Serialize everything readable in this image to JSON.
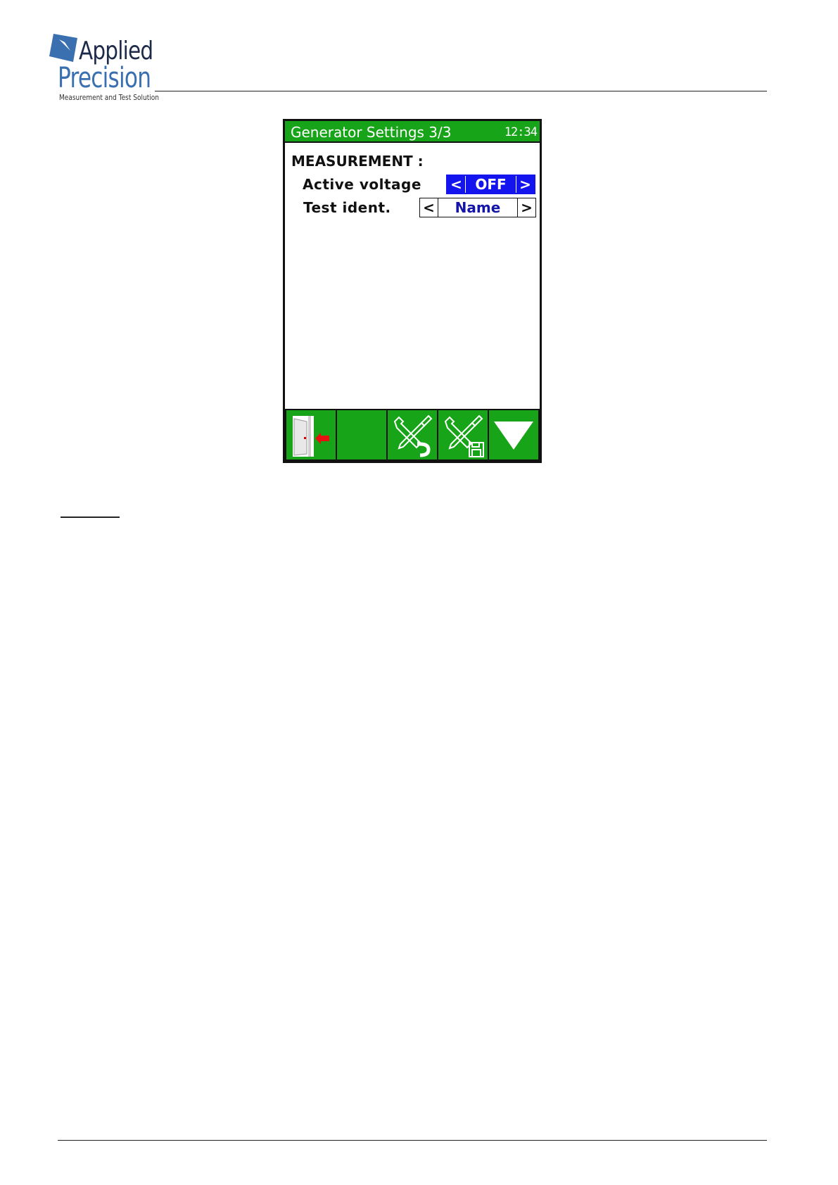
{
  "brand": {
    "name_line1": "Applied",
    "name_line2": "Precision",
    "tagline": "Measurement and Test Solution",
    "primary_color": "#3a6fb0"
  },
  "device": {
    "title": "Generator Settings 3/3",
    "time": "12:34",
    "title_bar_color": "#18a418",
    "section": "MEASUREMENT :",
    "settings": [
      {
        "label": "Active voltage",
        "value": "OFF",
        "prev": "<",
        "next": ">",
        "selected": true
      },
      {
        "label": "Test ident.",
        "value": "Name",
        "prev": "<",
        "next": ">",
        "selected": false
      }
    ],
    "toolbar": [
      {
        "icon": "exit-door-icon"
      },
      {
        "icon": "empty"
      },
      {
        "icon": "tools-reset-icon"
      },
      {
        "icon": "tools-save-icon"
      },
      {
        "icon": "arrow-down-icon"
      }
    ],
    "selection_color": "#1414ee"
  }
}
